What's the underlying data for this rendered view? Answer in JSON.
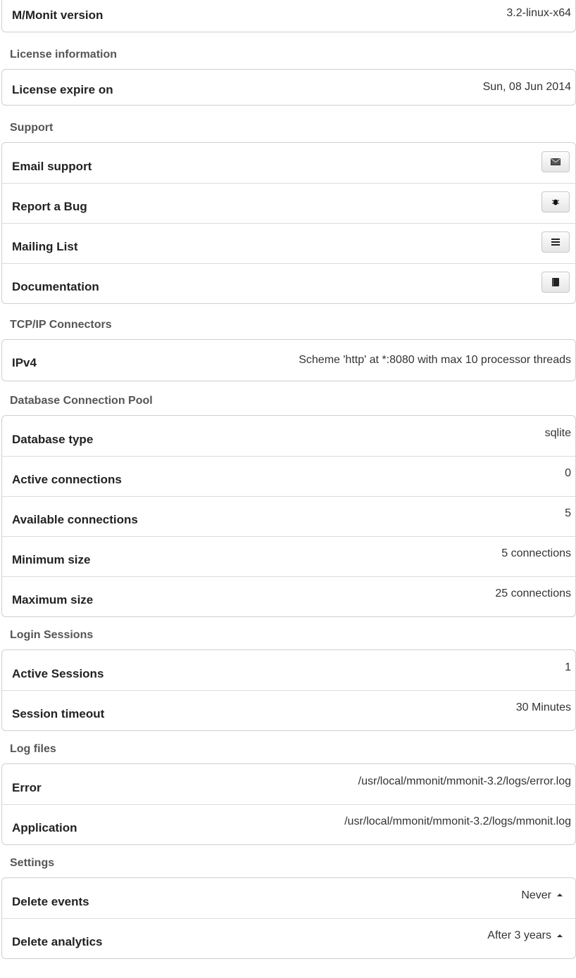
{
  "top": {
    "label": "M/Monit version",
    "value": "3.2-linux-x64"
  },
  "license": {
    "title": "License information",
    "label": "License expire on",
    "value": "Sun, 08 Jun 2014"
  },
  "support": {
    "title": "Support",
    "items": [
      {
        "label": "Email support",
        "icon": "envelope-icon"
      },
      {
        "label": "Report a Bug",
        "icon": "bug-icon"
      },
      {
        "label": "Mailing List",
        "icon": "list-icon"
      },
      {
        "label": "Documentation",
        "icon": "book-icon"
      }
    ]
  },
  "tcp": {
    "title": "TCP/IP Connectors",
    "label": "IPv4",
    "value": "Scheme 'http' at *:8080 with max 10 processor threads"
  },
  "db": {
    "title": "Database Connection Pool",
    "rows": [
      {
        "label": "Database type",
        "value": "sqlite"
      },
      {
        "label": "Active connections",
        "value": "0"
      },
      {
        "label": "Available connections",
        "value": "5"
      },
      {
        "label": "Minimum size",
        "value": "5 connections"
      },
      {
        "label": "Maximum size",
        "value": "25 connections"
      }
    ]
  },
  "sessions": {
    "title": "Login Sessions",
    "rows": [
      {
        "label": "Active Sessions",
        "value": "1"
      },
      {
        "label": "Session timeout",
        "value": "30 Minutes"
      }
    ]
  },
  "logs": {
    "title": "Log files",
    "rows": [
      {
        "label": "Error",
        "value": "/usr/local/mmonit/mmonit-3.2/logs/error.log"
      },
      {
        "label": "Application",
        "value": "/usr/local/mmonit/mmonit-3.2/logs/mmonit.log"
      }
    ]
  },
  "settings": {
    "title": "Settings",
    "rows": [
      {
        "label": "Delete events",
        "value": "Never"
      },
      {
        "label": "Delete analytics",
        "value": "After 3 years"
      }
    ]
  }
}
